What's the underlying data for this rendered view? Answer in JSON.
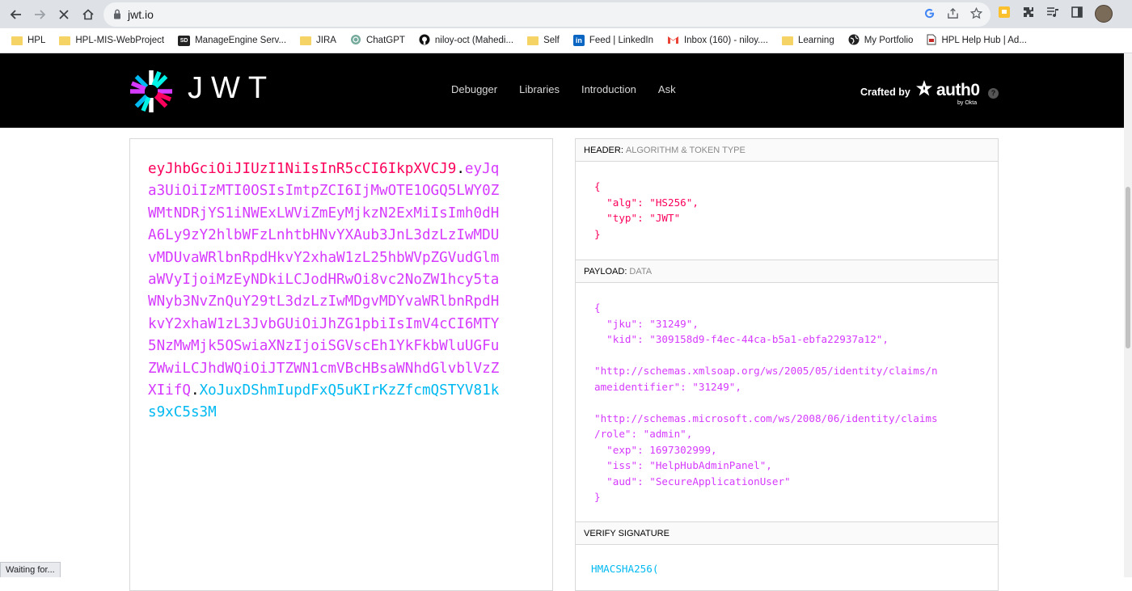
{
  "browser": {
    "url": "jwt.io",
    "bookmarks": [
      {
        "label": "HPL",
        "icon": "folder-icon"
      },
      {
        "label": "HPL-MIS-WebProject",
        "icon": "folder-icon"
      },
      {
        "label": "ManageEngine Serv...",
        "icon": "sd-icon"
      },
      {
        "label": "JIRA",
        "icon": "folder-icon"
      },
      {
        "label": "ChatGPT",
        "icon": "chatgpt-icon"
      },
      {
        "label": "niloy-oct (Mahedi...",
        "icon": "github-icon"
      },
      {
        "label": "Self",
        "icon": "folder-icon"
      },
      {
        "label": "Feed | LinkedIn",
        "icon": "linkedin-icon"
      },
      {
        "label": "Inbox (160) - niloy....",
        "icon": "gmail-icon"
      },
      {
        "label": "Learning",
        "icon": "folder-icon"
      },
      {
        "label": "My Portfolio",
        "icon": "globe-icon"
      },
      {
        "label": "HPL Help Hub | Ad...",
        "icon": "page-icon"
      }
    ],
    "status": "Waiting for..."
  },
  "site": {
    "logo_text": "JWT",
    "nav": [
      "Debugger",
      "Libraries",
      "Introduction",
      "Ask"
    ],
    "crafted_by": "Crafted by",
    "brand": "auth0",
    "brand_sub": "by Okta",
    "help": "?"
  },
  "encoded": {
    "header": "eyJhbGciOiJIUzI1NiIsInR5cCI6IkpXVCJ9",
    "payload": "eyJqa3UiOiIzMTI0OSIsImtpZCI6IjMwOTE1OGQ5LWY0ZWMtNDRjYS1iNWExLWViZmEyMjkzN2ExMiIsImh0dHA6Ly9zY2hlbWFzLnhtbHNvYXAub3JnL3dzLzIwMDUvMDUvaWRlbnRpdHkvY2xhaW1zL25hbWVpZGVudGlmaWVyIjoiMzEyNDkiLCJodHRwOi8vc2NoZW1hcy5taWNyb3NvZnQuY29tL3dzLzIwMDgvMDYvaWRlbnRpdHkvY2xhaW1zL3JvbGUiOiJhZG1pbiIsImV4cCI6MTY5NzMwMjk5OSwiaXNzIjoiSGVscEh1YkFkbWluUGFuZWwiLCJhdWQiOiJTZWN1cmVBcHBsaWNhdGlvblVzZXIifQ",
    "signature": "XoJuxDShmIupdFxQ5uKIrKzZfcmQSTYV81ks9xC5s3M",
    "dot": "."
  },
  "decoded": {
    "header_label": "HEADER:",
    "header_sub": "ALGORITHM & TOKEN TYPE",
    "header_lines": [
      "{",
      "  \"alg\": \"HS256\",",
      "  \"typ\": \"JWT\"",
      "}"
    ],
    "payload_label": "PAYLOAD:",
    "payload_sub": "DATA",
    "payload_lines": [
      "{",
      "  \"jku\": \"31249\",",
      "  \"kid\": \"309158d9-f4ec-44ca-b5a1-ebfa22937a12\",",
      "",
      "\"http://schemas.xmlsoap.org/ws/2005/05/identity/claims/n",
      "ameidentifier\": \"31249\",",
      "",
      "\"http://schemas.microsoft.com/ws/2008/06/identity/claims",
      "/role\": \"admin\",",
      "  \"exp\": 1697302999,",
      "  \"iss\": \"HelpHubAdminPanel\",",
      "  \"aud\": \"SecureApplicationUser\"",
      "}"
    ],
    "verify_label": "VERIFY SIGNATURE",
    "verify_fn": "HMACSHA256("
  }
}
